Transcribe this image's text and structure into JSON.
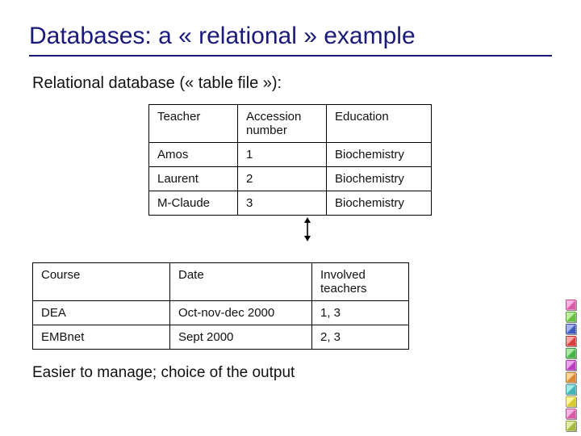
{
  "title": "Databases: a « relational » example",
  "subtitle": "Relational database (« table file »):",
  "table1": {
    "headers": [
      "Teacher",
      "Accession number",
      "Education"
    ],
    "rows": [
      [
        "Amos",
        "1",
        "Biochemistry"
      ],
      [
        "Laurent",
        "2",
        "Biochemistry"
      ],
      [
        "M-Claude",
        "3",
        "Biochemistry"
      ]
    ]
  },
  "table2": {
    "headers": [
      "Course",
      "Date",
      "Involved teachers"
    ],
    "rows": [
      [
        "DEA",
        "Oct-nov-dec 2000",
        "1, 3"
      ],
      [
        "EMBnet",
        "Sept 2000",
        "2, 3"
      ]
    ]
  },
  "footer": "Easier to manage; choice of the output",
  "colors": {
    "title": "#1a1a7a",
    "squares": [
      "#c3d94a",
      "#ff69c7",
      "#ffee33",
      "#4bd4d4",
      "#ffa23a",
      "#d94adf",
      "#52d452",
      "#ff4a4a",
      "#4a6adf",
      "#7ae04a",
      "#ff69c7"
    ]
  }
}
